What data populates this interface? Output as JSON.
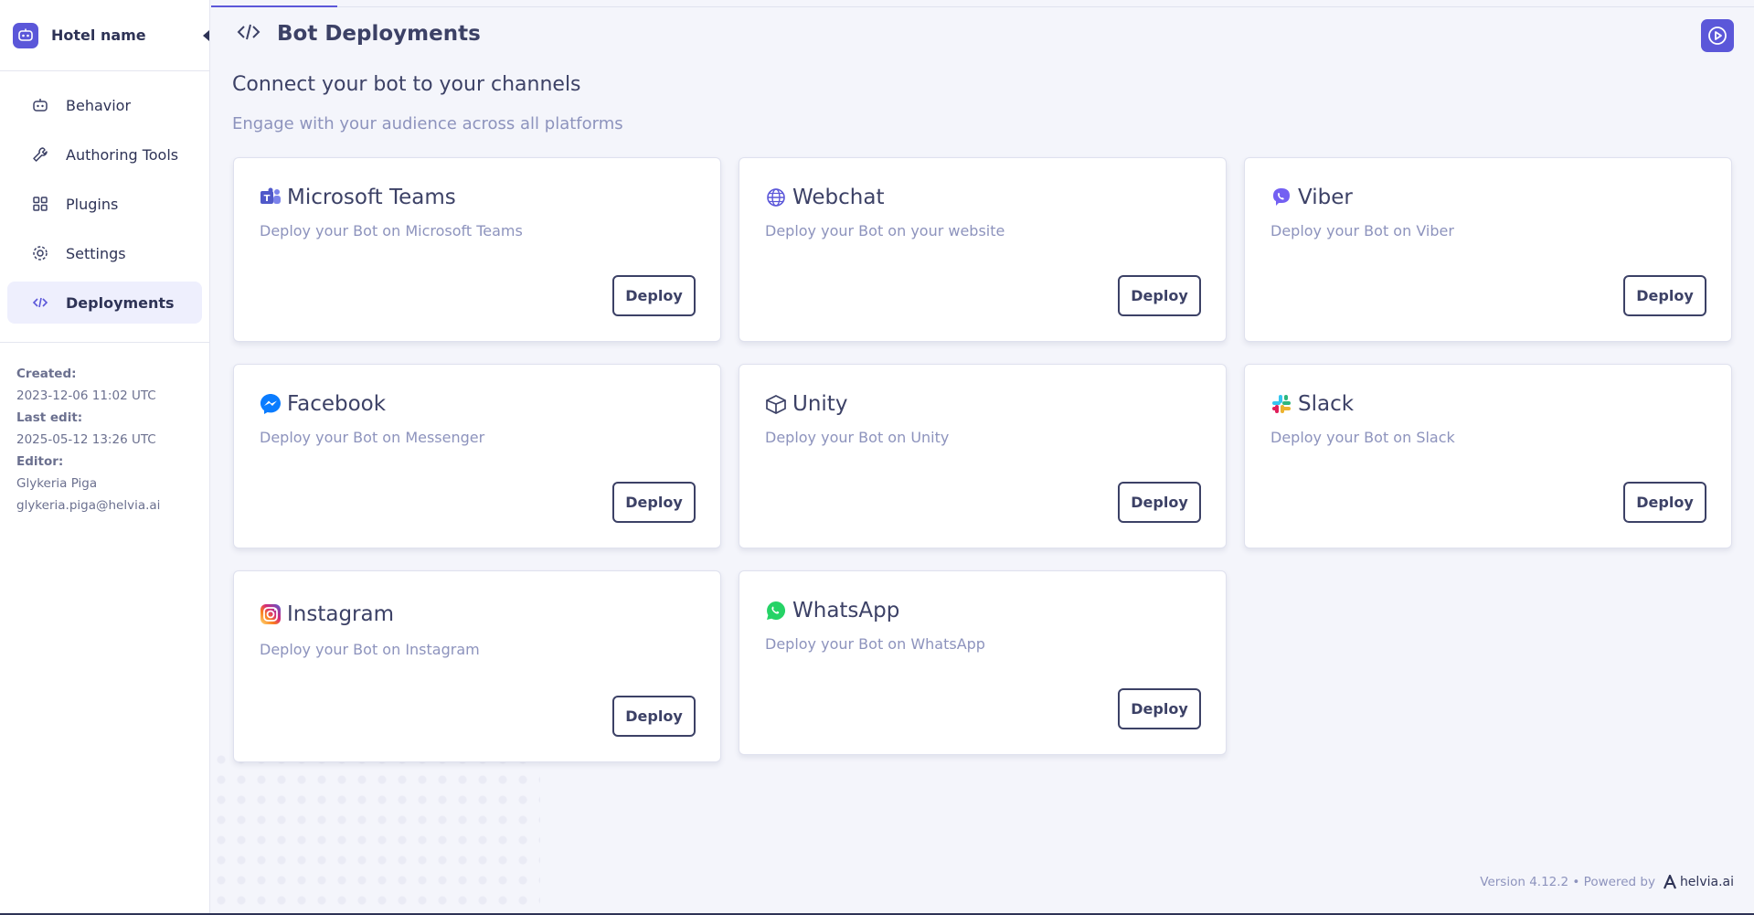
{
  "sidebar": {
    "brand_name": "Hotel name",
    "items": [
      {
        "label": "Behavior",
        "icon": "robot-icon"
      },
      {
        "label": "Authoring Tools",
        "icon": "wrench-icon"
      },
      {
        "label": "Plugins",
        "icon": "plugins-icon"
      },
      {
        "label": "Settings",
        "icon": "gear-icon"
      },
      {
        "label": "Deployments",
        "icon": "code-icon",
        "active": true
      }
    ],
    "meta": {
      "created_label": "Created:",
      "created_value": "2023-12-06 11:02 UTC",
      "last_edit_label": "Last edit:",
      "last_edit_value": "2025-05-12 13:26 UTC",
      "editor_label": "Editor:",
      "editor_name": "Glykeria Piga",
      "editor_email": "glykeria.piga@helvia.ai"
    }
  },
  "header": {
    "title": "Bot Deployments"
  },
  "main": {
    "section_title": "Connect your bot to your channels",
    "section_subtitle": "Engage with your audience across all platforms",
    "deploy_label": "Deploy",
    "channels": [
      {
        "title": "Microsoft Teams",
        "desc": "Deploy your Bot on Microsoft Teams",
        "icon": "microsoft-teams-icon",
        "color": "#5059c9"
      },
      {
        "title": "Webchat",
        "desc": "Deploy your Bot on your website",
        "icon": "globe-icon",
        "color": "#5b57d9"
      },
      {
        "title": "Viber",
        "desc": "Deploy your Bot on Viber",
        "icon": "viber-icon",
        "color": "#7360f2"
      },
      {
        "title": "Facebook",
        "desc": "Deploy your Bot on Messenger",
        "icon": "messenger-icon",
        "color": "#0a7cff"
      },
      {
        "title": "Unity",
        "desc": "Deploy your Bot on Unity",
        "icon": "unity-icon",
        "color": "#3c4166"
      },
      {
        "title": "Slack",
        "desc": "Deploy your Bot on Slack",
        "icon": "slack-icon",
        "color": "#e01e5a"
      },
      {
        "title": "Instagram",
        "desc": "Deploy your Bot on Instagram",
        "icon": "instagram-icon",
        "color": "#d62976"
      },
      {
        "title": "WhatsApp",
        "desc": "Deploy your Bot on WhatsApp",
        "icon": "whatsapp-icon",
        "color": "#25d366"
      }
    ]
  },
  "footer": {
    "version_text": "Version 4.12.2 • Powered by",
    "brand": "helvia.ai"
  },
  "colors": {
    "accent": "#5b57d9",
    "text": "#3c4166",
    "muted": "#8d93bd"
  }
}
